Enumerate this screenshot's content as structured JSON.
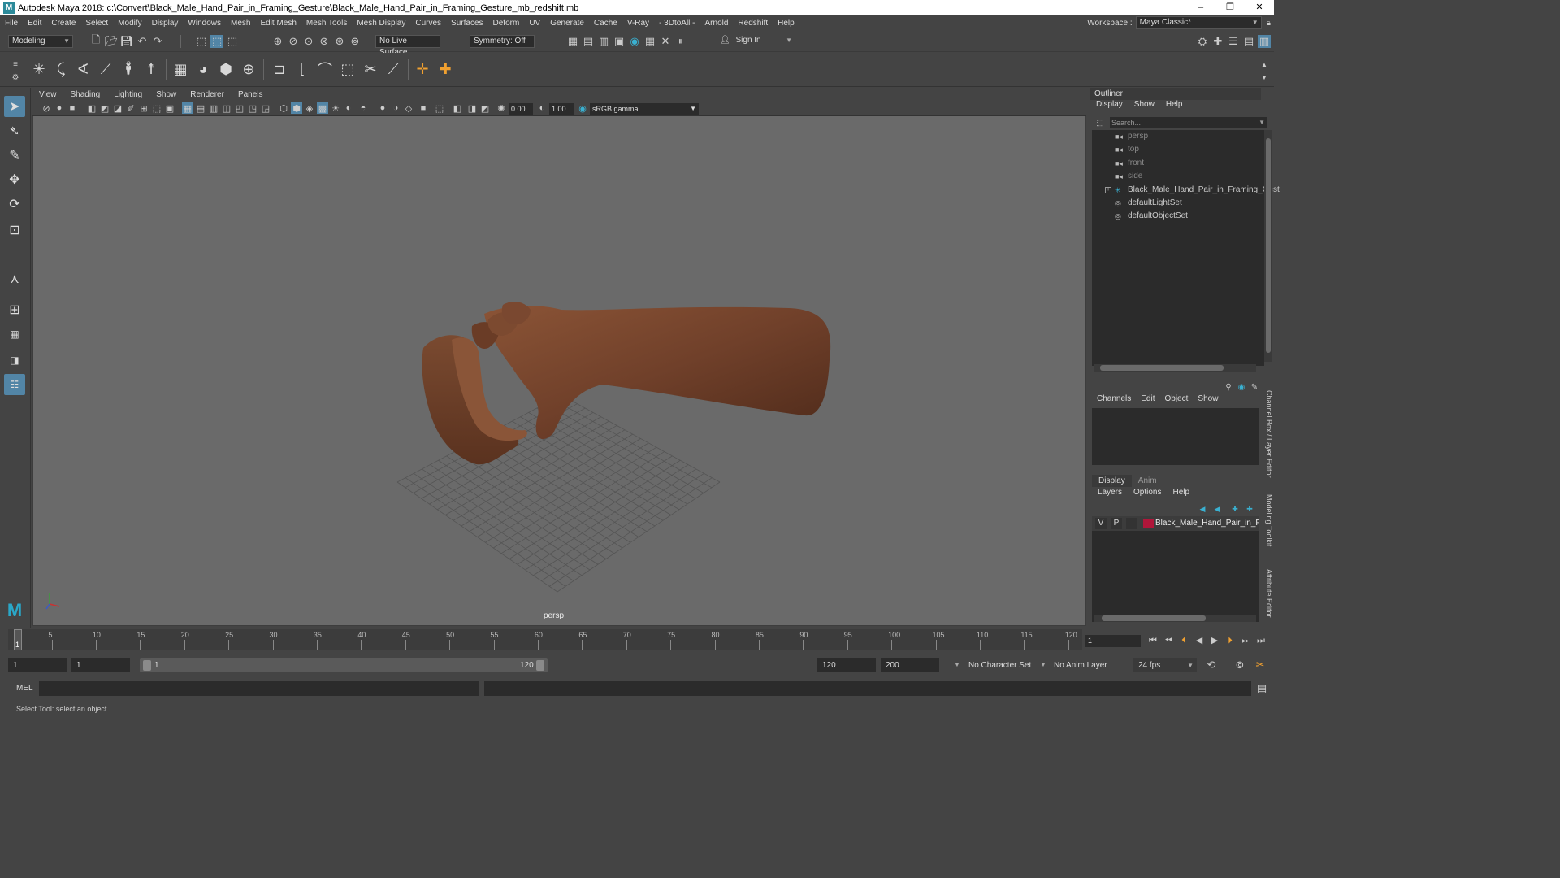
{
  "window": {
    "title": "Autodesk Maya 2018: c:\\Convert\\Black_Male_Hand_Pair_in_Framing_Gesture\\Black_Male_Hand_Pair_in_Framing_Gesture_mb_redshift.mb",
    "minimize": "–",
    "maximize": "❐",
    "close": "✕"
  },
  "menubar": {
    "items": [
      "File",
      "Edit",
      "Create",
      "Select",
      "Modify",
      "Display",
      "Windows",
      "Mesh",
      "Edit Mesh",
      "Mesh Tools",
      "Mesh Display",
      "Curves",
      "Surfaces",
      "Deform",
      "UV",
      "Generate",
      "Cache",
      "V-Ray",
      "- 3DtoAll -",
      "Arnold",
      "Redshift",
      "Help"
    ],
    "workspace_label": "Workspace :",
    "workspace_value": "Maya Classic*"
  },
  "statusline": {
    "mode": "Modeling",
    "live_surface": "No Live Surface",
    "symmetry": "Symmetry: Off",
    "sign_in": "Sign In"
  },
  "viewport": {
    "menu": [
      "View",
      "Shading",
      "Lighting",
      "Show",
      "Renderer",
      "Panels"
    ],
    "exposure": "0.00",
    "gamma": "1.00",
    "color_space": "sRGB gamma",
    "camera_label": "persp"
  },
  "outliner": {
    "title": "Outliner",
    "menu": [
      "Display",
      "Show",
      "Help"
    ],
    "search_placeholder": "Search...",
    "items": [
      {
        "label": "persp",
        "kind": "camera",
        "dim": true
      },
      {
        "label": "top",
        "kind": "camera",
        "dim": true
      },
      {
        "label": "front",
        "kind": "camera",
        "dim": true
      },
      {
        "label": "side",
        "kind": "camera",
        "dim": true
      },
      {
        "label": "Black_Male_Hand_Pair_in_Framing_Gest",
        "kind": "group",
        "dim": false
      },
      {
        "label": "defaultLightSet",
        "kind": "set",
        "dim": false
      },
      {
        "label": "defaultObjectSet",
        "kind": "set",
        "dim": false
      }
    ]
  },
  "channel_box": {
    "menu": [
      "Channels",
      "Edit",
      "Object",
      "Show"
    ]
  },
  "layer_editor": {
    "tabs": [
      "Display",
      "Anim"
    ],
    "menu": [
      "Layers",
      "Options",
      "Help"
    ],
    "layer": {
      "v": "V",
      "p": "P",
      "name": "Black_Male_Hand_Pair_in_Fran",
      "color": "#b0163a"
    }
  },
  "side_tabs": [
    "Channel Box / Layer Editor",
    "Modeling Toolkit",
    "Attribute Editor"
  ],
  "timeline": {
    "ticks": [
      "5",
      "10",
      "15",
      "20",
      "25",
      "30",
      "35",
      "40",
      "45",
      "50",
      "55",
      "60",
      "65",
      "70",
      "75",
      "80",
      "85",
      "90",
      "95",
      "100",
      "105",
      "110",
      "115",
      "120"
    ],
    "current_frame_marker": "1",
    "current_frame": "1"
  },
  "range": {
    "start": "1",
    "playback_start": "1",
    "slider_start": "1",
    "slider_end": "120",
    "playback_end": "120",
    "end": "200",
    "character_set": "No Character Set",
    "anim_layer": "No Anim Layer",
    "fps": "24 fps"
  },
  "command_line": {
    "label": "MEL"
  },
  "help_line": "Select Tool: select an object"
}
